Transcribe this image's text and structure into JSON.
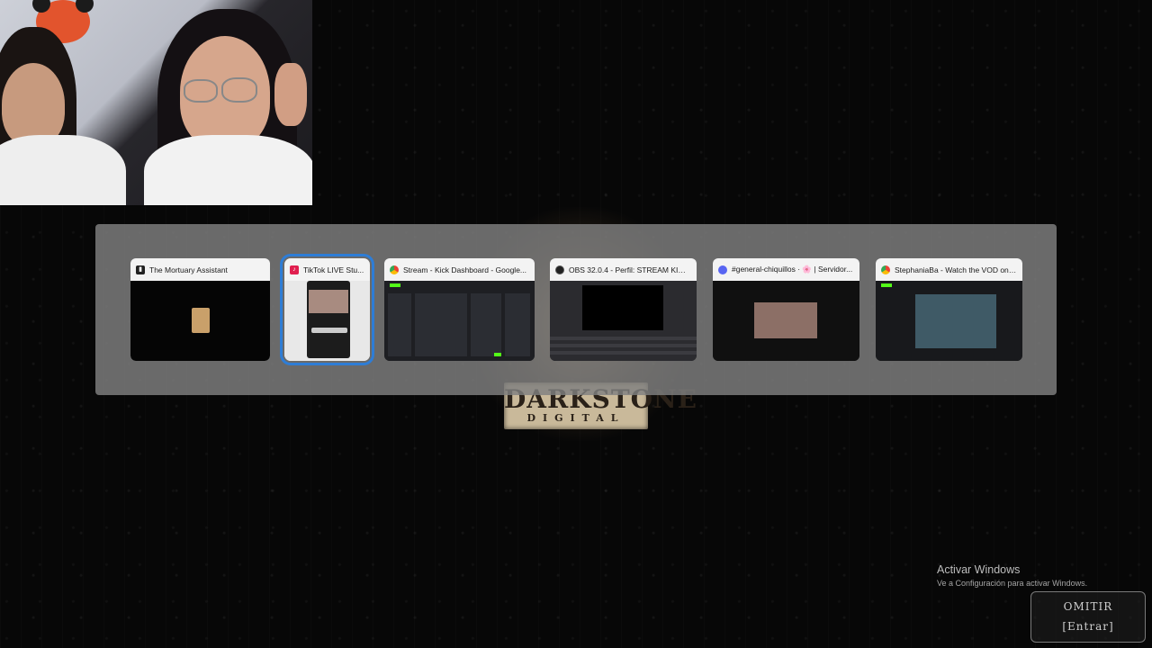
{
  "background": {
    "logo_main": "DARKSTONE",
    "logo_sub": "DIGITAL"
  },
  "switcher": {
    "windows": [
      {
        "title": "The Mortuary Assistant",
        "icon": "mortuary-icon",
        "selected": false
      },
      {
        "title": "TikTok LIVE Stu...",
        "icon": "tiktok-icon",
        "selected": true
      },
      {
        "title": "Stream - Kick Dashboard - Google...",
        "icon": "chrome-icon",
        "selected": false
      },
      {
        "title": "OBS 32.0.4 - Perfil: STREAM KICK ...",
        "icon": "obs-icon",
        "selected": false
      },
      {
        "title": "#general-chiquillos · 🌸 | Servidor...",
        "icon": "discord-icon",
        "selected": false
      },
      {
        "title": "StephaniaBa - Watch the VOD on K...",
        "icon": "chrome-icon",
        "selected": false
      }
    ]
  },
  "watermark": {
    "title": "Activar Windows",
    "subtitle": "Ve a Configuración para activar Windows."
  },
  "skip": {
    "label": "OMITIR",
    "hint": "[Entrar]"
  }
}
